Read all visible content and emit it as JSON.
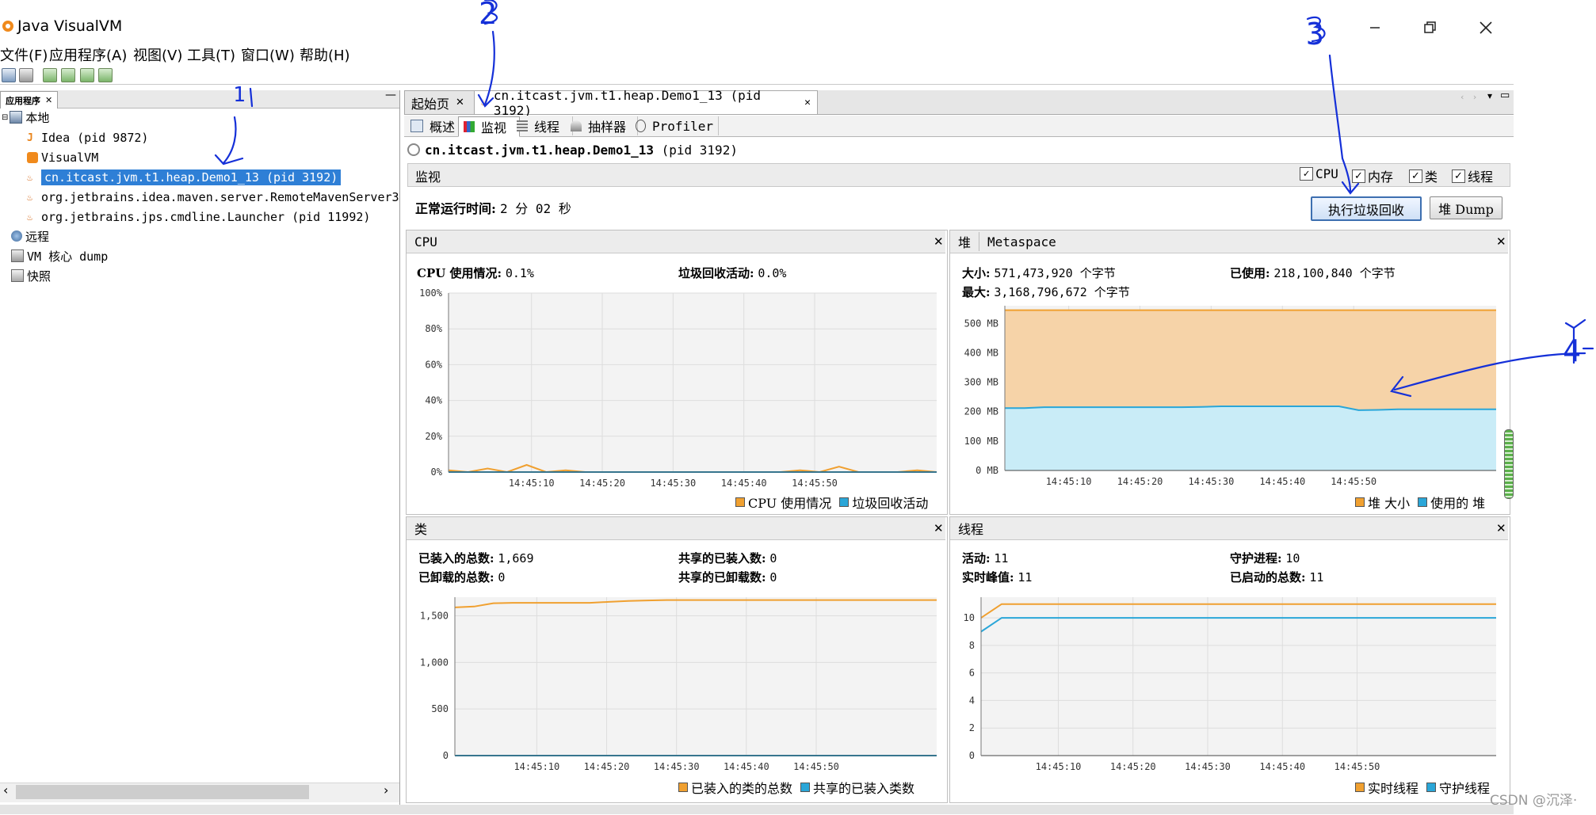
{
  "window": {
    "title": "Java VisualVM",
    "controls": [
      "minimize-icon",
      "restore-icon",
      "close-icon"
    ]
  },
  "menu": [
    "文件(F)",
    "应用程序(A)",
    "视图(V)",
    "工具(T)",
    "窗口(W)",
    "帮助(H)"
  ],
  "left": {
    "tab_label": "应用程序",
    "tree": [
      {
        "label": "本地",
        "level": 0
      },
      {
        "label": "Idea (pid 9872)",
        "level": 1
      },
      {
        "label": "VisualVM",
        "level": 1
      },
      {
        "label": "cn.itcast.jvm.t1.heap.Demo1_13 (pid 3192)",
        "level": 1,
        "selected": true
      },
      {
        "label": "org.jetbrains.idea.maven.server.RemoteMavenServer3",
        "level": 1
      },
      {
        "label": "org.jetbrains.jps.cmdline.Launcher (pid 11992)",
        "level": 1
      },
      {
        "label": "远程",
        "level": 0
      },
      {
        "label": "VM 核心 dump",
        "level": 0
      },
      {
        "label": "快照",
        "level": 0
      }
    ]
  },
  "doc_tabs": [
    "起始页",
    "cn.itcast.jvm.t1.heap.Demo1_13 (pid 3192)"
  ],
  "subtabs": [
    "概述",
    "监视",
    "线程",
    "抽样器",
    "Profiler"
  ],
  "process_title": "cn.itcast.jvm.t1.heap.Demo1_13",
  "process_pid": "(pid 3192)",
  "monitor": {
    "label": "监视",
    "checkboxes": [
      "CPU",
      "内存",
      "类",
      "线程"
    ],
    "uptime_label": "正常运行时间:",
    "uptime_value": "2 分 02 秒",
    "gc_button": "执行垃圾回收",
    "heapdump_button": "堆 Dump"
  },
  "panels": {
    "cpu": {
      "title": "CPU",
      "usage_label": "CPU 使用情况:",
      "usage_value": "0.1%",
      "gc_label": "垃圾回收活动:",
      "gc_value": "0.0%",
      "legend": [
        "CPU 使用情况",
        "垃圾回收活动"
      ]
    },
    "heap": {
      "tabs": [
        "堆",
        "Metaspace"
      ],
      "size_label": "大小:",
      "size_value": "571,473,920 个字节",
      "used_label": "已使用:",
      "used_value": "218,100,840 个字节",
      "max_label": "最大:",
      "max_value": "3,168,796,672 个字节",
      "legend": [
        "堆 大小",
        "使用的 堆"
      ]
    },
    "classes": {
      "title": "类",
      "loaded_label": "已装入的总数:",
      "loaded_value": "1,669",
      "unloaded_label": "已卸载的总数:",
      "unloaded_value": "0",
      "shared_loaded_label": "共享的已装入数:",
      "shared_loaded_value": "0",
      "shared_unloaded_label": "共享的已卸载数:",
      "shared_unloaded_value": "0",
      "legend": [
        "已装入的类的总数",
        "共享的已装入类数"
      ]
    },
    "threads": {
      "title": "线程",
      "live_label": "活动:",
      "live_value": "11",
      "peak_label": "实时峰值:",
      "peak_value": "11",
      "daemon_label": "守护进程:",
      "daemon_value": "10",
      "started_label": "已启动的总数:",
      "started_value": "11",
      "legend": [
        "实时线程",
        "守护线程"
      ]
    }
  },
  "colors": {
    "series_orange": "#f0a030",
    "series_blue": "#2aa6d8",
    "heap_fill": "#f6d3a8",
    "used_fill": "#c9ecf7",
    "selection": "#2e7fd6",
    "annotation": "#1530d8"
  },
  "annotations": [
    "1",
    "2",
    "3",
    "4"
  ],
  "chart_data": [
    {
      "type": "area",
      "name": "cpu",
      "x": [
        "14:45:10",
        "14:45:20",
        "14:45:30",
        "14:45:40",
        "14:45:50"
      ],
      "yticks": [
        "0%",
        "20%",
        "40%",
        "60%",
        "80%",
        "100%"
      ],
      "ylim": [
        0,
        100
      ],
      "series": [
        {
          "name": "CPU 使用情况",
          "color": "#f0a030",
          "values": [
            1,
            0,
            2,
            0,
            4,
            0,
            1,
            0,
            0,
            0,
            0,
            0,
            0,
            0,
            0,
            0,
            0,
            0,
            1,
            0,
            3,
            0,
            0,
            0,
            1,
            0
          ]
        },
        {
          "name": "垃圾回收活动",
          "color": "#2aa6d8",
          "values": [
            0,
            0,
            0,
            0,
            0,
            0,
            0,
            0,
            0,
            0,
            0,
            0,
            0,
            0,
            0,
            0,
            0,
            0,
            0,
            0,
            0,
            0,
            0,
            0,
            0,
            0
          ]
        }
      ]
    },
    {
      "type": "area",
      "name": "heap",
      "x": [
        "14:45:10",
        "14:45:20",
        "14:45:30",
        "14:45:40",
        "14:45:50"
      ],
      "yticks": [
        "0 MB",
        "100 MB",
        "200 MB",
        "300 MB",
        "400 MB",
        "500 MB"
      ],
      "ylim": [
        0,
        560
      ],
      "series": [
        {
          "name": "堆 大小",
          "color": "#f0a030",
          "values": [
            545,
            545,
            545,
            545,
            545,
            545,
            545,
            545,
            545,
            545,
            545,
            545,
            545,
            545,
            545,
            545,
            545,
            545,
            545,
            545,
            545,
            545,
            545,
            545,
            545,
            545
          ]
        },
        {
          "name": "使用的 堆",
          "color": "#2aa6d8",
          "values": [
            212,
            212,
            215,
            215,
            215,
            215,
            215,
            215,
            215,
            215,
            216,
            218,
            218,
            218,
            218,
            218,
            218,
            218,
            205,
            206,
            208,
            208,
            208,
            208,
            208,
            208
          ]
        }
      ]
    },
    {
      "type": "line",
      "name": "classes",
      "x": [
        "14:45:10",
        "14:45:20",
        "14:45:30",
        "14:45:40",
        "14:45:50"
      ],
      "yticks": [
        "0",
        "500",
        "1,000",
        "1,500"
      ],
      "ylim": [
        0,
        1700
      ],
      "series": [
        {
          "name": "已装入的类的总数",
          "color": "#f0a030",
          "values": [
            1590,
            1600,
            1635,
            1640,
            1640,
            1640,
            1640,
            1640,
            1650,
            1660,
            1665,
            1669,
            1669,
            1669,
            1669,
            1669,
            1669,
            1669,
            1669,
            1669,
            1669,
            1669,
            1669,
            1669,
            1669,
            1669
          ]
        },
        {
          "name": "共享的已装入类数",
          "color": "#2aa6d8",
          "values": [
            0,
            0,
            0,
            0,
            0,
            0,
            0,
            0,
            0,
            0,
            0,
            0,
            0,
            0,
            0,
            0,
            0,
            0,
            0,
            0,
            0,
            0,
            0,
            0,
            0,
            0
          ]
        }
      ]
    },
    {
      "type": "line",
      "name": "threads",
      "x": [
        "14:45:10",
        "14:45:20",
        "14:45:30",
        "14:45:40",
        "14:45:50"
      ],
      "yticks": [
        "0",
        "2",
        "4",
        "6",
        "8",
        "10"
      ],
      "ylim": [
        0,
        11.5
      ],
      "series": [
        {
          "name": "实时线程",
          "color": "#f0a030",
          "values": [
            10,
            11,
            11,
            11,
            11,
            11,
            11,
            11,
            11,
            11,
            11,
            11,
            11,
            11,
            11,
            11,
            11,
            11,
            11,
            11,
            11,
            11,
            11,
            11,
            11,
            11
          ]
        },
        {
          "name": "守护线程",
          "color": "#2aa6d8",
          "values": [
            9,
            10,
            10,
            10,
            10,
            10,
            10,
            10,
            10,
            10,
            10,
            10,
            10,
            10,
            10,
            10,
            10,
            10,
            10,
            10,
            10,
            10,
            10,
            10,
            10,
            10
          ]
        }
      ]
    }
  ]
}
